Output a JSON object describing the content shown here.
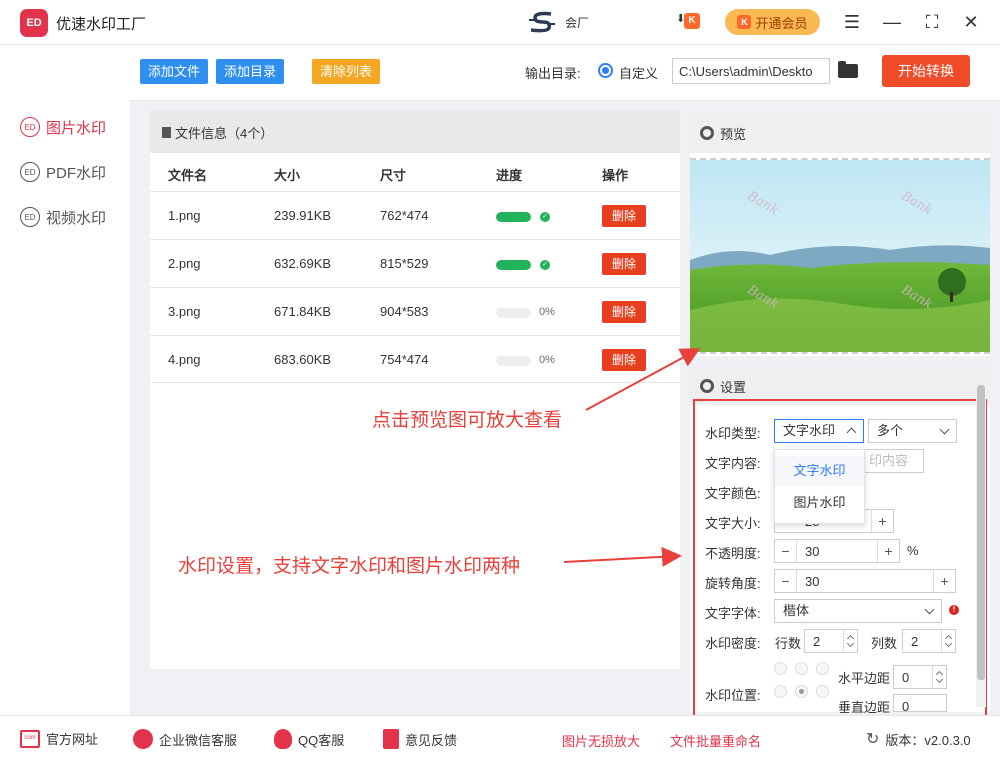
{
  "app": {
    "logo_text": "ED",
    "title": "优速水印工厂",
    "brand_text": "会厂",
    "vip_label": "开通会员",
    "win_menu": "☰",
    "win_min": "—",
    "win_max": "⛶",
    "win_close": "✕"
  },
  "sidebar": {
    "items": [
      {
        "label": "图片水印",
        "icon": "stamp-icon",
        "active": true
      },
      {
        "label": "PDF水印",
        "icon": "stamp-icon",
        "active": false
      },
      {
        "label": "视频水印",
        "icon": "stamp-icon",
        "active": false
      }
    ]
  },
  "toolbar": {
    "add_file": "添加文件",
    "add_dir": "添加目录",
    "clear_list": "清除列表",
    "output_label": "输出目录:",
    "output_option": "自定义",
    "output_path": "C:\\Users\\admin\\Deskto",
    "start": "开始转换"
  },
  "files": {
    "header": "文件信息（4个）",
    "columns": [
      "文件名",
      "大小",
      "尺寸",
      "进度",
      "操作"
    ],
    "rows": [
      {
        "name": "1.png",
        "size": "239.91KB",
        "dims": "762*474",
        "progress": 1.0,
        "pct": "",
        "action": "删除"
      },
      {
        "name": "2.png",
        "size": "632.69KB",
        "dims": "815*529",
        "progress": 1.0,
        "pct": "",
        "action": "删除"
      },
      {
        "name": "3.png",
        "size": "671.84KB",
        "dims": "904*583",
        "progress": 0.0,
        "pct": "0%",
        "action": "删除"
      },
      {
        "name": "4.png",
        "size": "683.60KB",
        "dims": "754*474",
        "progress": 0.0,
        "pct": "0%",
        "action": "删除"
      }
    ]
  },
  "preview": {
    "title": "预览",
    "watermarks": [
      "Bank",
      "Bank",
      "Bank",
      "Bank"
    ]
  },
  "settings": {
    "title": "设置",
    "type_label": "水印类型:",
    "type_value": "文字水印",
    "count_value": "多个",
    "dropdown_options": [
      "文字水印",
      "图片水印"
    ],
    "content_label": "文字内容:",
    "content_placeholder": "印内容",
    "color_label": "文字颜色:",
    "size_label": "文字大小:",
    "size_value": "28",
    "opacity_label": "不透明度:",
    "opacity_value": "30",
    "opacity_unit": "%",
    "rotate_label": "旋转角度:",
    "rotate_value": "30",
    "font_label": "文字字体:",
    "font_value": "楷体",
    "density_label": "水印密度:",
    "rows_label": "行数",
    "rows_value": "2",
    "cols_label": "列数",
    "cols_value": "2",
    "position_label": "水印位置:",
    "hmargin_label": "水平边距",
    "hmargin_value": "0",
    "vmargin_label": "垂直边距",
    "vmargin_value": "0"
  },
  "annotations": {
    "preview_hint": "点击预览图可放大查看",
    "settings_hint": "水印设置，支持文字水印和图片水印两种"
  },
  "footer": {
    "website": "官方网址",
    "wechat": "企业微信客服",
    "qq": "QQ客服",
    "feedback": "意见反馈",
    "lossless": "图片无损放大",
    "rename": "文件批量重命名",
    "version": "版本：v2.0.3.0"
  },
  "colors": {
    "accent": "#e3324b",
    "blue": "#2f7cf6",
    "orange": "#f5a623",
    "start": "#f04c2a",
    "annotation": "#e8403a",
    "progress": "#22b45a"
  }
}
